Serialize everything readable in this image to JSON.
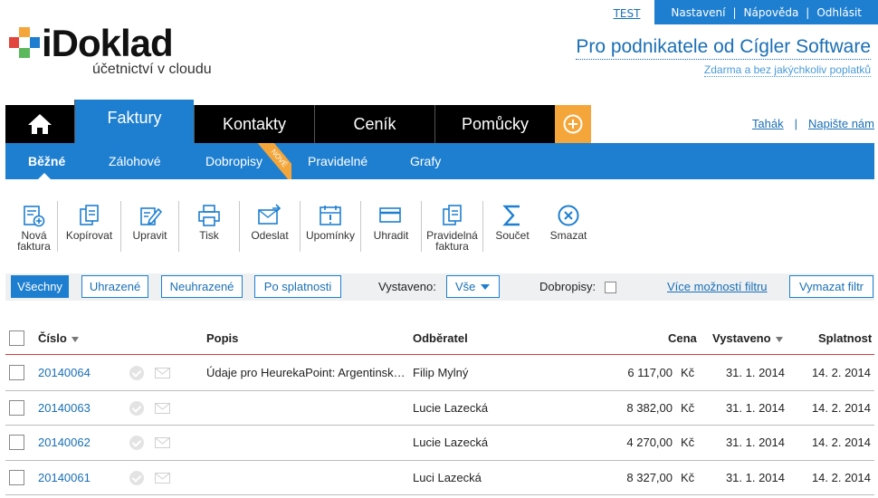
{
  "top": {
    "test_label": "TEST",
    "links": [
      "Nastavení",
      "Nápověda",
      "Odhlásit"
    ]
  },
  "logo": {
    "title": "iDoklad",
    "subtitle": "účetnictví v cloudu"
  },
  "promo": {
    "title": "Pro podnikatele od Cígler Software",
    "subtitle": "Zdarma a bez jakýchkoliv poplatků"
  },
  "nav": {
    "tabs": [
      "Faktury",
      "Kontakty",
      "Ceník",
      "Pomůcky"
    ],
    "active_tab": "Faktury",
    "right_links": [
      "Tahák",
      "Napište nám"
    ]
  },
  "subnav": {
    "items": [
      "Běžné",
      "Zálohové",
      "Dobropisy",
      "Pravidelné",
      "Grafy"
    ],
    "active": "Běžné",
    "new_badge": "NOVÉ"
  },
  "toolbar": {
    "items": [
      {
        "label": "Nová faktura",
        "icon": "new-invoice-icon"
      },
      {
        "label": "Kopírovat",
        "icon": "copy-icon"
      },
      {
        "label": "Upravit",
        "icon": "edit-icon"
      },
      {
        "label": "Tisk",
        "icon": "print-icon"
      },
      {
        "label": "Odeslat",
        "icon": "send-icon"
      },
      {
        "label": "Upomínky",
        "icon": "reminder-icon"
      },
      {
        "label": "Uhradit",
        "icon": "pay-icon"
      },
      {
        "label": "Pravidelná faktura",
        "icon": "recurring-invoice-icon"
      },
      {
        "label": "Součet",
        "icon": "sum-icon"
      },
      {
        "label": "Smazat",
        "icon": "delete-icon"
      }
    ]
  },
  "filters": {
    "buttons": [
      "Všechny",
      "Uhrazené",
      "Neuhrazené",
      "Po splatnosti"
    ],
    "active": "Všechny",
    "issued_label": "Vystaveno:",
    "issued_value": "Vše",
    "credit_label": "Dobropisy:",
    "more_filters": "Více možností filtru",
    "clear_filter": "Vymazat filtr"
  },
  "table": {
    "headers": {
      "number": "Číslo",
      "description": "Popis",
      "customer": "Odběratel",
      "price": "Cena",
      "issued": "Vystaveno",
      "due": "Splatnost"
    },
    "rows": [
      {
        "number": "20140064",
        "description": "Údaje pro HeurekaPoint: Argentinsk…",
        "customer": "Filip Mylný",
        "price": "6 117,00",
        "currency": "Kč",
        "issued": "31. 1. 2014",
        "due": "14. 2. 2014"
      },
      {
        "number": "20140063",
        "description": "",
        "customer": "Lucie Lazecká",
        "price": "8 382,00",
        "currency": "Kč",
        "issued": "31. 1. 2014",
        "due": "14. 2. 2014"
      },
      {
        "number": "20140062",
        "description": "",
        "customer": "Lucie Lazecká",
        "price": "4 270,00",
        "currency": "Kč",
        "issued": "31. 1. 2014",
        "due": "14. 2. 2014"
      },
      {
        "number": "20140061",
        "description": "",
        "customer": "Luci Lazecká",
        "price": "8 327,00",
        "currency": "Kč",
        "issued": "31. 1. 2014",
        "due": "14. 2. 2014"
      }
    ]
  },
  "colors": {
    "brand_blue": "#1e7fd1",
    "orange": "#f5a63a",
    "header_line": "#d43a3a"
  }
}
